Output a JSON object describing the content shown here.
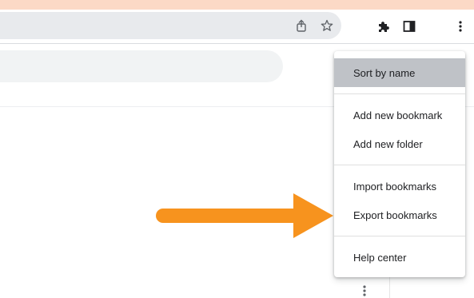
{
  "browser": {
    "omnibox_icons": [
      "share-icon",
      "star-icon"
    ],
    "toolbar_icons": [
      "extensions-icon",
      "side-panel-icon",
      "more-vert-icon"
    ]
  },
  "menu": {
    "items": [
      {
        "label": "Sort by name",
        "selected": true
      },
      {
        "label": "Add new bookmark"
      },
      {
        "label": "Add new folder"
      },
      {
        "label": "Import bookmarks"
      },
      {
        "label": "Export bookmarks"
      },
      {
        "label": "Help center"
      }
    ]
  },
  "colors": {
    "arrow": "#f7931e",
    "selected_item_bg": "#bfc2c7",
    "top_strip": "#fcd9c6"
  }
}
